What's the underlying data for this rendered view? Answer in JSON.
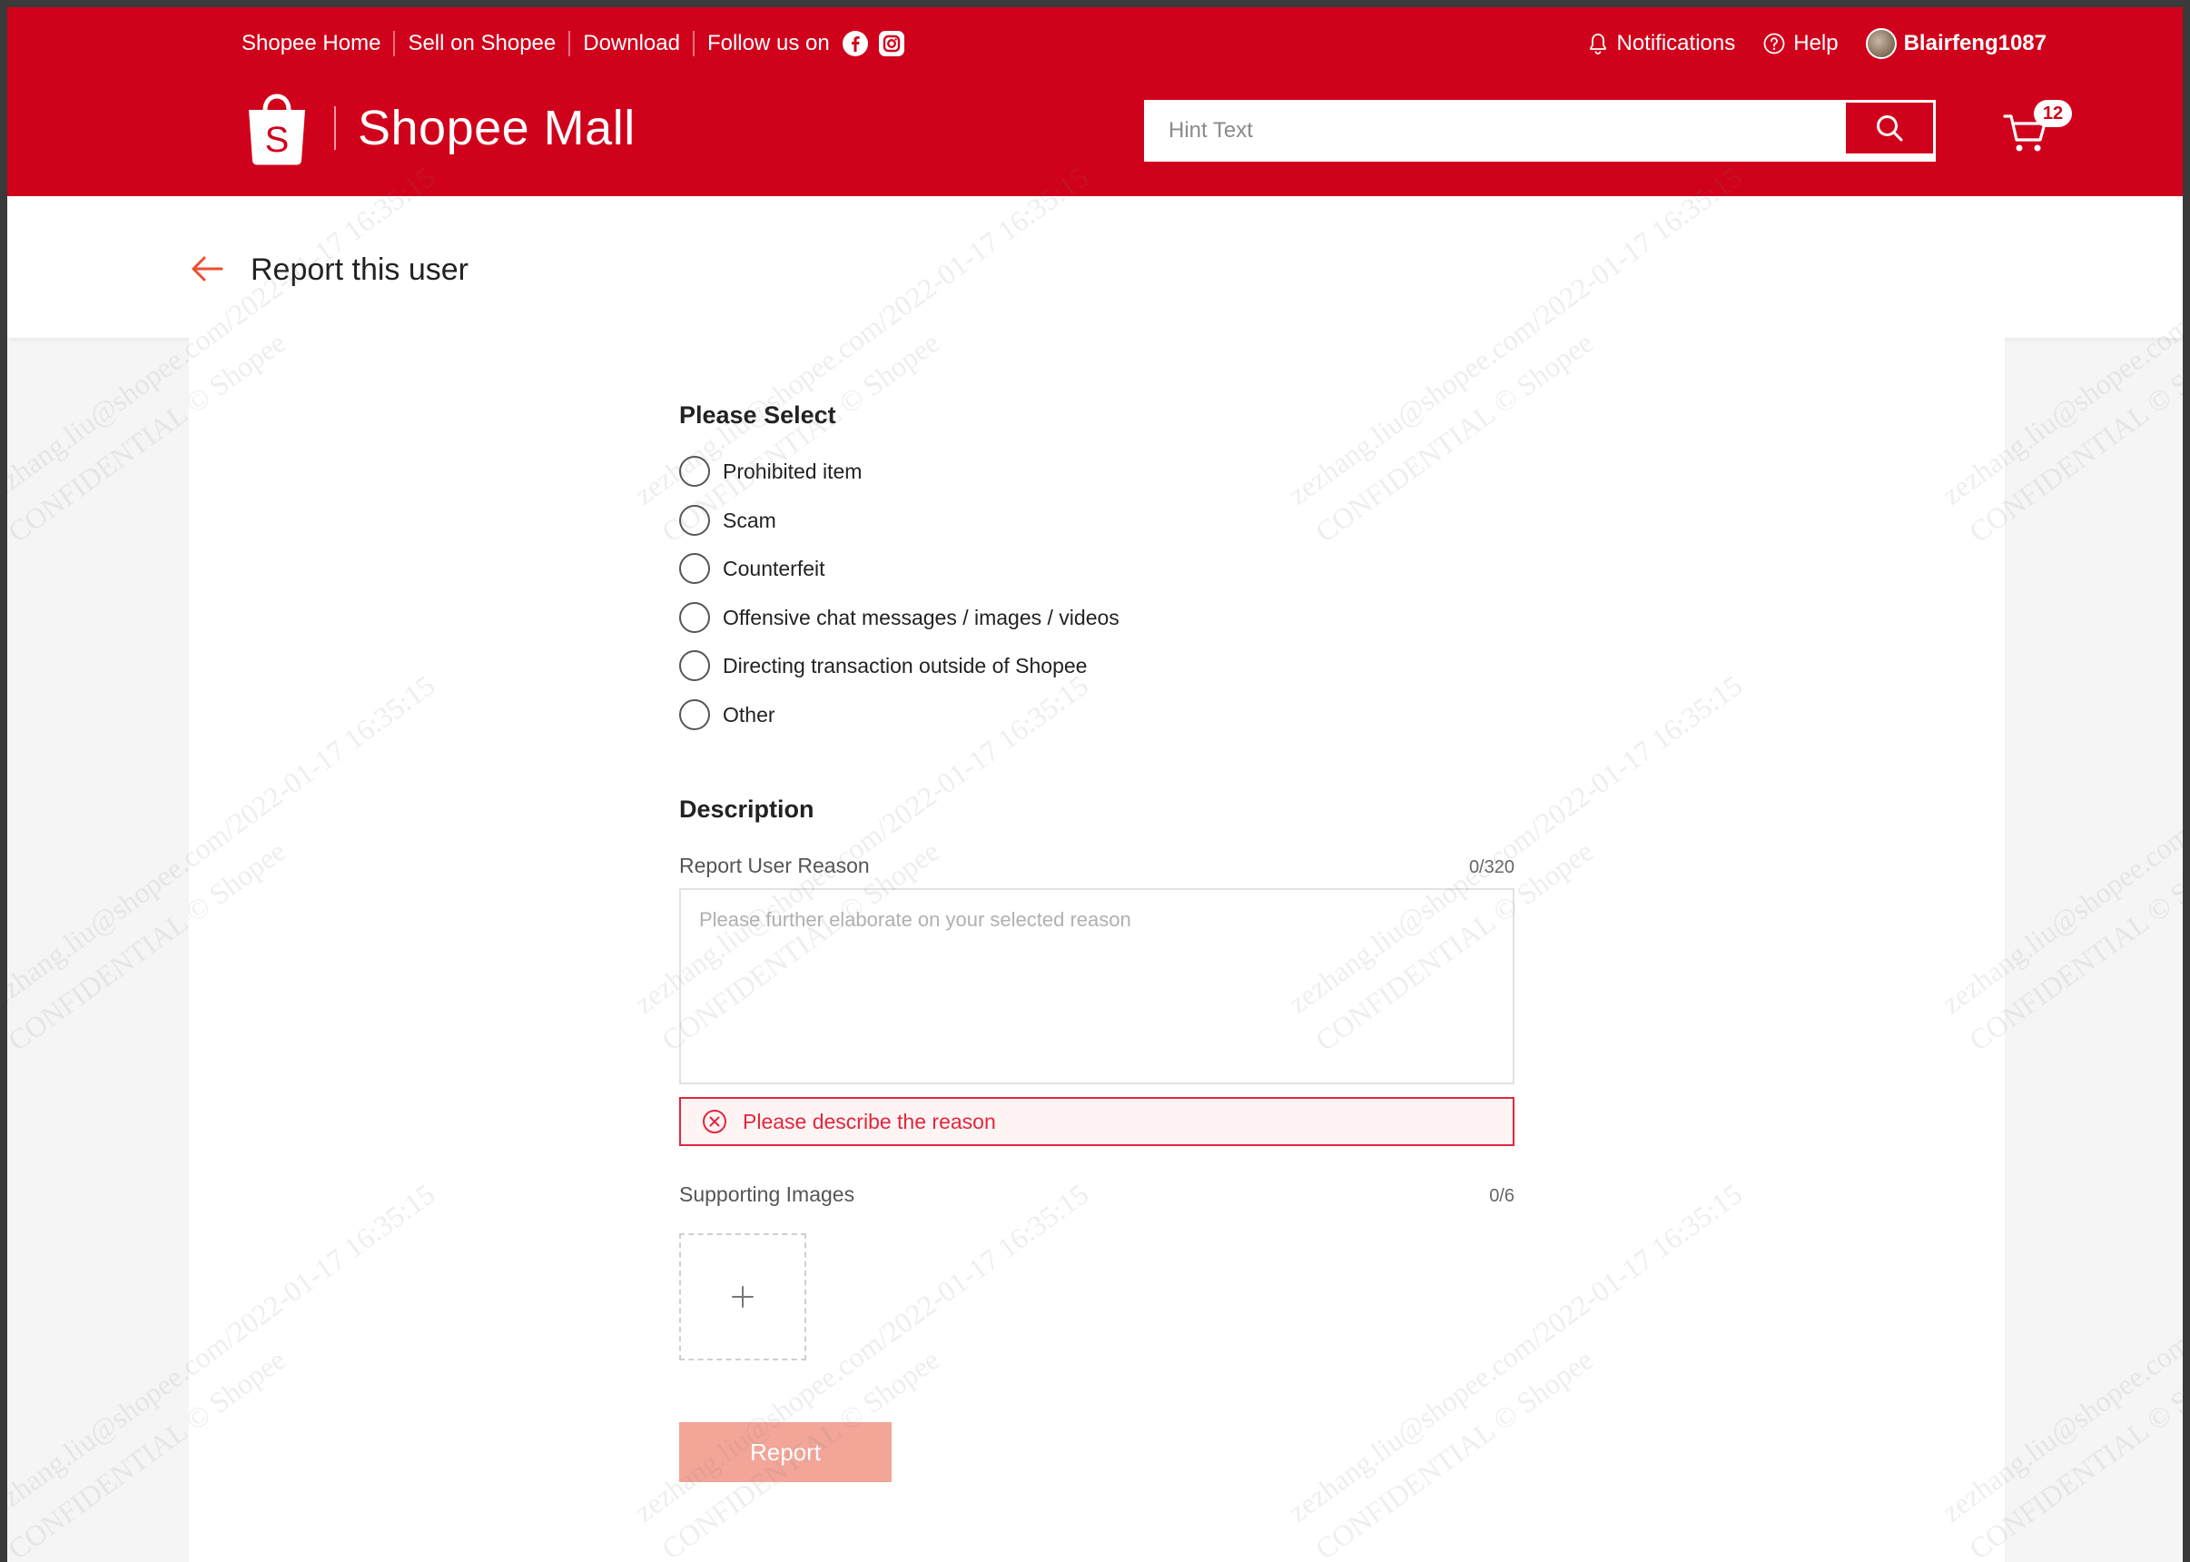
{
  "header": {
    "links": {
      "home": "Shopee Home",
      "sell": "Sell on Shopee",
      "download": "Download",
      "follow": "Follow us on"
    },
    "notifications": "Notifications",
    "help": "Help",
    "username": "Blairfeng1087",
    "logo_text": "Shopee Mall",
    "logo_letter": "S",
    "search_placeholder": "Hint Text",
    "cart_count": "12",
    "brand_color": "#d0011b"
  },
  "subheader": {
    "title": "Report this user"
  },
  "form": {
    "select_title": "Please Select",
    "options": [
      "Prohibited item",
      "Scam",
      "Counterfeit",
      "Offensive chat messages / images / videos",
      "Directing transaction outside of Shopee",
      "Other"
    ],
    "description_title": "Description",
    "reason_label": "Report User Reason",
    "reason_counter": "0/320",
    "reason_placeholder": "Please further elaborate on your selected reason",
    "error_text": "Please describe the reason",
    "images_label": "Supporting Images",
    "images_counter": "0/6",
    "report_button": "Report",
    "error_color": "#e2263d",
    "button_color": "#f3a598"
  },
  "watermark": {
    "line1": "zezhang.liu@shopee.com/2022-01-17 16:35:15",
    "line2": "CONFIDENTIAL © Shopee"
  }
}
